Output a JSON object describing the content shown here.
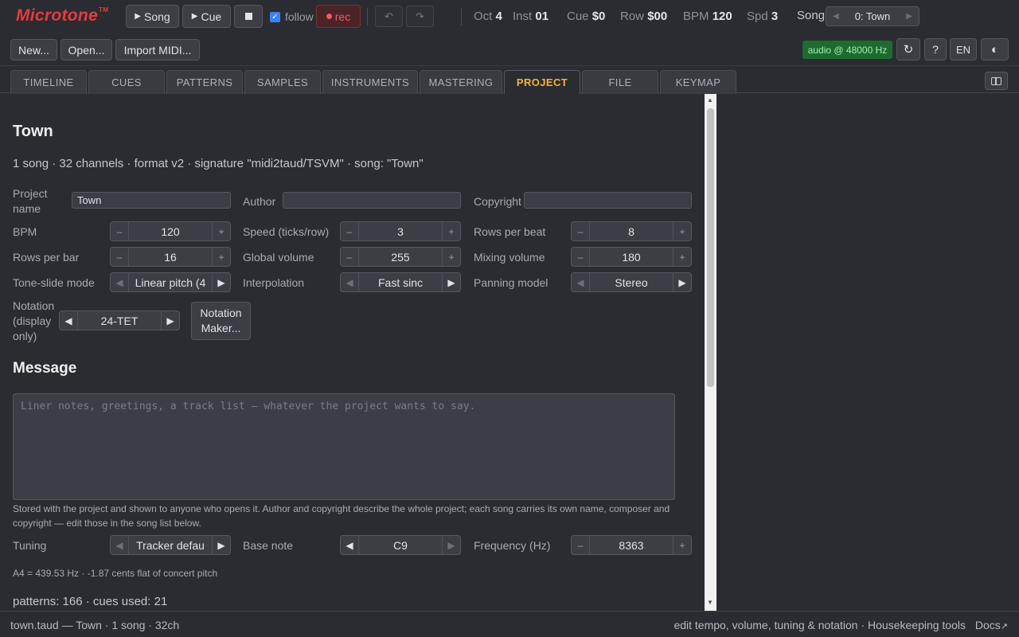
{
  "app": {
    "logo": "Microtone",
    "tm": "TM"
  },
  "transport": {
    "song_label": "Song",
    "cue_label": "Cue",
    "follow_label": "follow",
    "follow_checked": true,
    "rec_label": "rec"
  },
  "stats": {
    "oct_label": "Oct",
    "oct_value": "4",
    "inst_label": "Inst",
    "inst_value": "01",
    "cue_label": "Cue",
    "cue_value": "$0",
    "row_label": "Row",
    "row_value": "$00",
    "bpm_label": "BPM",
    "bpm_value": "120",
    "spd_label": "Spd",
    "spd_value": "3"
  },
  "song_select": {
    "label": "Song",
    "value": "0: Town"
  },
  "file_buttons": {
    "new": "New...",
    "open": "Open...",
    "import": "Import MIDI..."
  },
  "audio_status": "audio @ 48000 Hz",
  "toolbar_right": {
    "help": "?",
    "lang": "EN"
  },
  "tabs": [
    {
      "label": "TIMELINE"
    },
    {
      "label": "CUES"
    },
    {
      "label": "PATTERNS"
    },
    {
      "label": "SAMPLES"
    },
    {
      "label": "INSTRUMENTS"
    },
    {
      "label": "MASTERING"
    },
    {
      "label": "PROJECT"
    },
    {
      "label": "FILE"
    },
    {
      "label": "KEYMAP"
    }
  ],
  "active_tab": "PROJECT",
  "project": {
    "title": "Town",
    "summary": "1 song · 32 channels · format v2 · signature \"midi2taud/TSVM\" · song: \"Town\"",
    "fields": {
      "project_name_label": "Project name",
      "project_name_value": "Town",
      "author_label": "Author",
      "author_value": "",
      "copyright_label": "Copyright",
      "copyright_value": ""
    },
    "steppers": {
      "bpm_label": "BPM",
      "bpm_value": "120",
      "speed_label": "Speed (ticks/row)",
      "speed_value": "3",
      "rows_per_beat_label": "Rows per beat",
      "rows_per_beat_value": "8",
      "rows_per_bar_label": "Rows per bar",
      "rows_per_bar_value": "16",
      "global_volume_label": "Global volume",
      "global_volume_value": "255",
      "mixing_volume_label": "Mixing volume",
      "mixing_volume_value": "180",
      "tone_slide_label": "Tone-slide mode",
      "tone_slide_value": "Linear pitch (4",
      "interpolation_label": "Interpolation",
      "interpolation_value": "Fast sinc",
      "panning_label": "Panning model",
      "panning_value": "Stereo",
      "notation_label": "Notation (display only)",
      "notation_value": "24-TET"
    },
    "notation_maker_label": "Notation Maker...",
    "message_heading": "Message",
    "message_placeholder": "Liner notes, greetings, a track list — whatever the project wants to say.",
    "message_note": "Stored with the project and shown to anyone who opens it. Author and copyright describe the whole project; each song carries its own name, composer and copyright — edit those in the song list below.",
    "tuning": {
      "tuning_label": "Tuning",
      "tuning_value": "Tracker defau",
      "base_note_label": "Base note",
      "base_note_value": "C9",
      "frequency_label": "Frequency (Hz)",
      "frequency_value": "8363"
    },
    "pitch_note": "A4 = 439.53 Hz · -1.87 cents flat of concert pitch",
    "counts": "patterns: 166 · cues used: 21"
  },
  "statusbar": {
    "left": "town.taud — Town · 1 song · 32ch",
    "right": "edit tempo, volume, tuning & notation · Housekeeping tools",
    "docs": "Docs"
  },
  "colors": {
    "accent": "#f2b33d",
    "logo": "#e83a3f",
    "rec": "#ef5c61",
    "audio_ok": "#1f6b2f"
  }
}
